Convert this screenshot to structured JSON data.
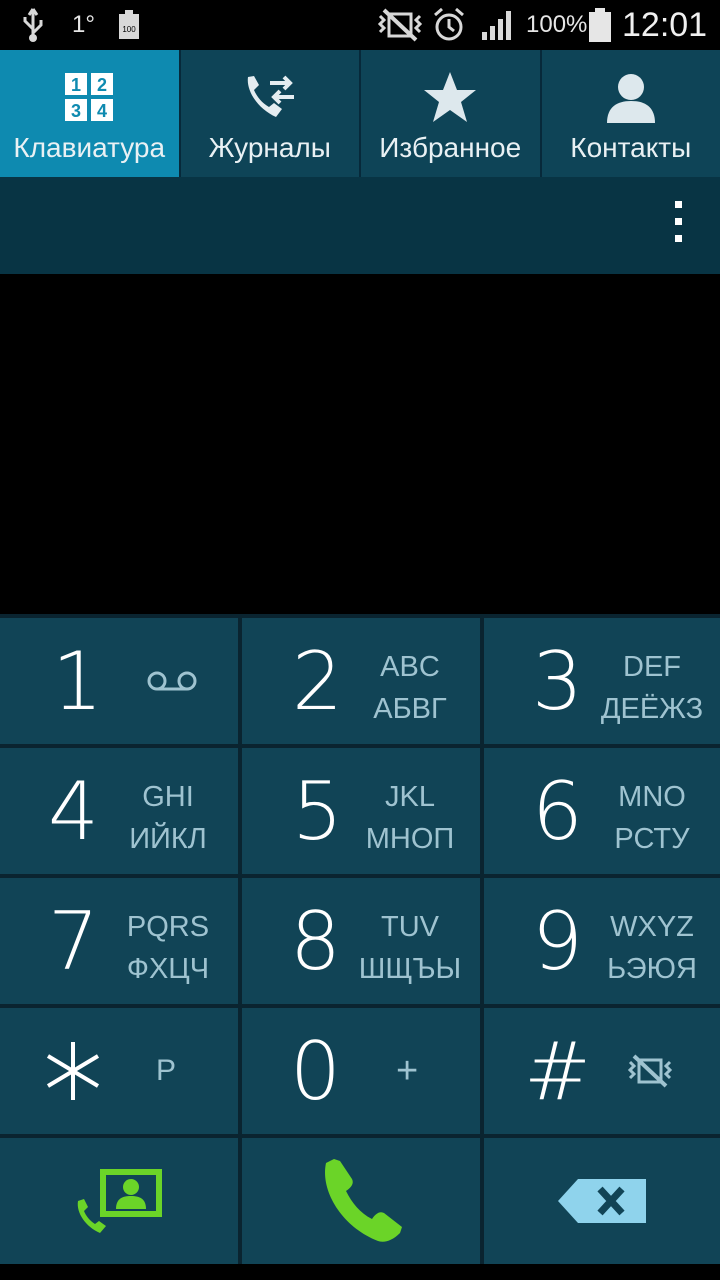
{
  "status_bar": {
    "icons": [
      "usb-icon",
      "temperature-icon",
      "battery-saver-icon",
      "vibrate-mute-icon",
      "alarm-icon",
      "signal-icon",
      "battery-icon"
    ],
    "temperature": "1°",
    "battery_small_label": "100",
    "battery_percent": "100%",
    "time": "12:01"
  },
  "tabs": [
    {
      "label": "Клавиатура",
      "icon": "keypad-icon",
      "active": true
    },
    {
      "label": "Журналы",
      "icon": "call-log-icon",
      "active": false
    },
    {
      "label": "Избранное",
      "icon": "star-icon",
      "active": false
    },
    {
      "label": "Контакты",
      "icon": "contact-icon",
      "active": false
    }
  ],
  "action_bar": {
    "menu_icon": "overflow-menu-icon"
  },
  "keypad": {
    "keys": [
      {
        "digit": "1",
        "latin": "",
        "cyrillic": "",
        "extra_icon": "voicemail-icon"
      },
      {
        "digit": "2",
        "latin": "ABC",
        "cyrillic": "АБВГ"
      },
      {
        "digit": "3",
        "latin": "DEF",
        "cyrillic": "ДЕЁЖЗ"
      },
      {
        "digit": "4",
        "latin": "GHI",
        "cyrillic": "ИЙКЛ"
      },
      {
        "digit": "5",
        "latin": "JKL",
        "cyrillic": "МНОП"
      },
      {
        "digit": "6",
        "latin": "MNO",
        "cyrillic": "РСТУ"
      },
      {
        "digit": "7",
        "latin": "PQRS",
        "cyrillic": "ФХЦЧ"
      },
      {
        "digit": "8",
        "latin": "TUV",
        "cyrillic": "ШЩЪЫ"
      },
      {
        "digit": "9",
        "latin": "WXYZ",
        "cyrillic": "ЬЭЮЯ"
      },
      {
        "digit": "*",
        "secondary": "P"
      },
      {
        "digit": "0",
        "secondary": "+"
      },
      {
        "digit": "#",
        "extra_icon": "vibrate-mute-icon"
      }
    ],
    "actions": [
      {
        "name": "add-contact",
        "icon": "add-to-contacts-icon",
        "color": "#6bd428"
      },
      {
        "name": "call",
        "icon": "phone-call-icon",
        "color": "#6bd428"
      },
      {
        "name": "backspace",
        "icon": "backspace-icon",
        "color": "#8fd3ec"
      }
    ]
  },
  "colors": {
    "tab_active": "#0e8ab0",
    "tab_inactive": "#0e4457",
    "key_bg": "#114456",
    "key_letters": "#9fc3d0",
    "call_green": "#6bd428"
  }
}
